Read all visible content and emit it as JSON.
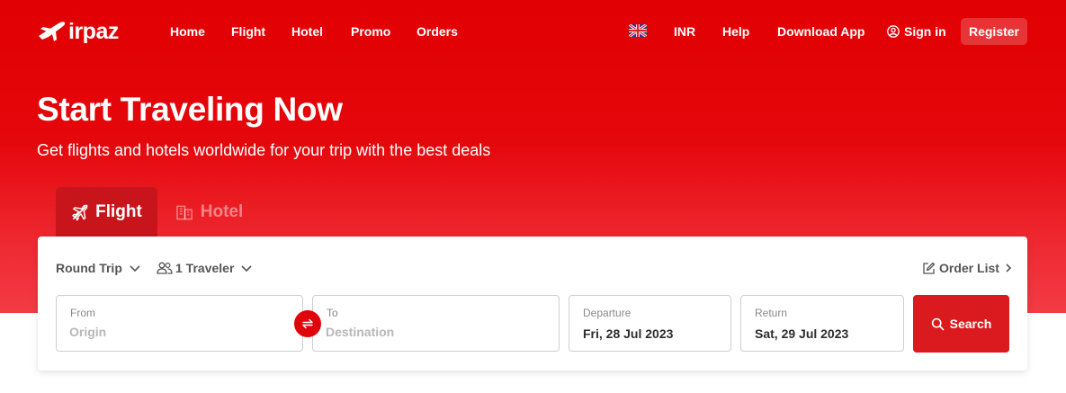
{
  "brand": {
    "logo_text": "irpaz"
  },
  "nav": {
    "links": [
      "Home",
      "Flight",
      "Hotel",
      "Promo",
      "Orders"
    ],
    "currency": "INR",
    "help": "Help",
    "download": "Download App",
    "signin": "Sign in",
    "register": "Register"
  },
  "hero": {
    "title": "Start Traveling Now",
    "subtitle": "Get flights and hotels worldwide for your trip with the best deals"
  },
  "tabs": [
    {
      "label": "Flight",
      "active": true
    },
    {
      "label": "Hotel",
      "active": false
    }
  ],
  "search": {
    "trip_type": "Round Trip",
    "travelers": "1 Traveler",
    "order_list": "Order List",
    "from": {
      "label": "From",
      "placeholder": "Origin"
    },
    "to": {
      "label": "To",
      "placeholder": "Destination"
    },
    "departure": {
      "label": "Departure",
      "value": "Fri, 28 Jul 2023"
    },
    "return": {
      "label": "Return",
      "value": "Sat, 29 Jul 2023"
    },
    "button": "Search"
  },
  "colors": {
    "brand_red": "#e00309",
    "button_red": "#db1a20",
    "tab_active": "#c8151b"
  },
  "icons": [
    "plane-logo-icon",
    "uk-flag-icon",
    "user-circle-icon",
    "plane-icon",
    "building-icon",
    "chevron-down-icon",
    "users-icon",
    "edit-icon",
    "chevron-right-icon",
    "swap-icon",
    "search-icon"
  ]
}
